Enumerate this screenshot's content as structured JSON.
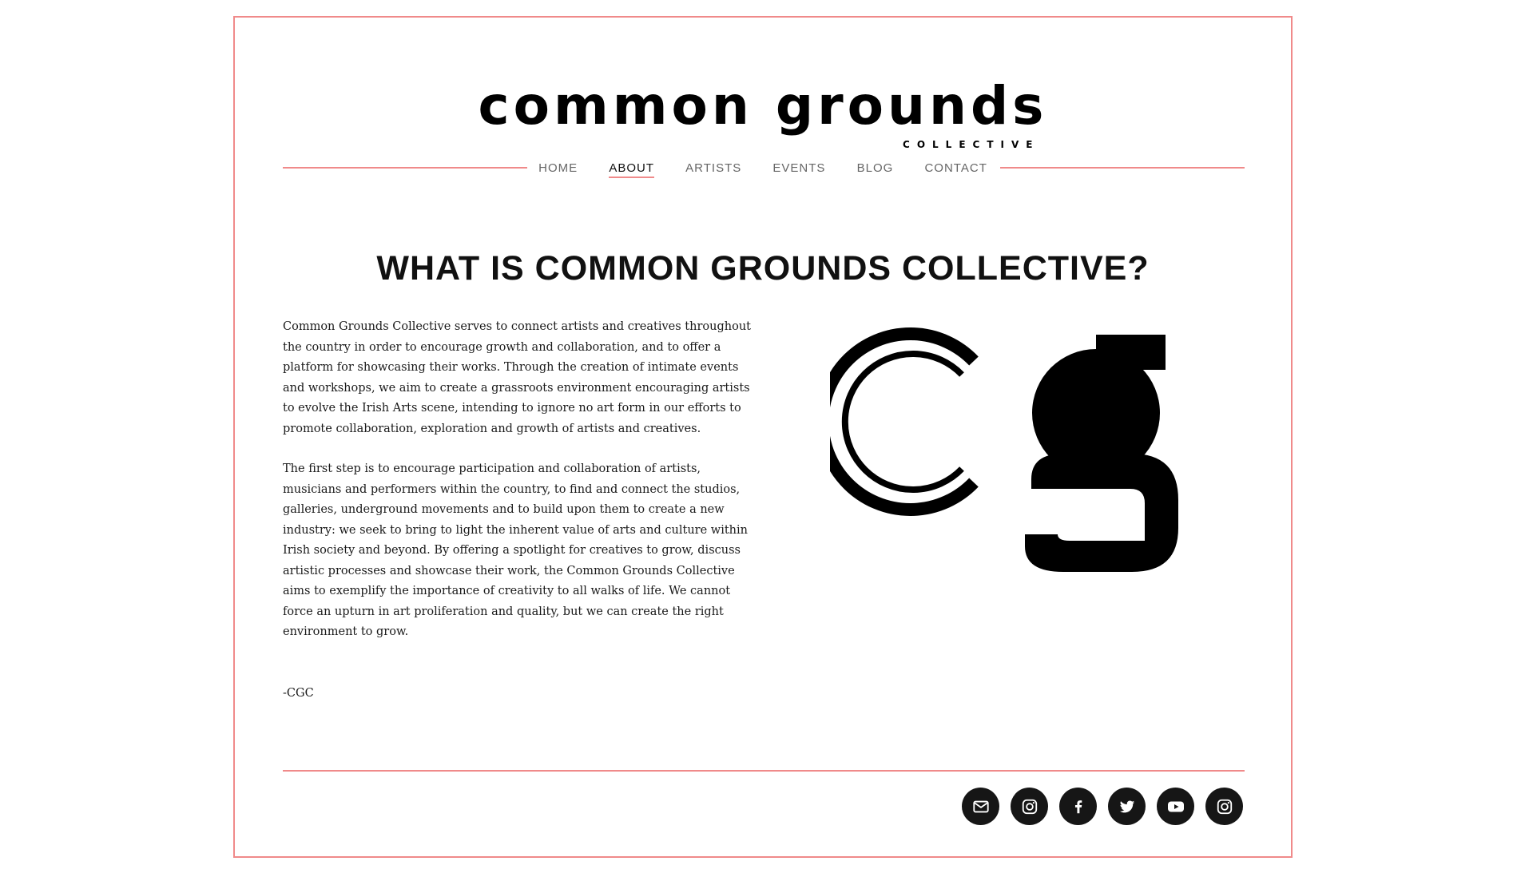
{
  "logo": {
    "main": "common grounds",
    "sub": "COLLECTIVE"
  },
  "nav": {
    "items": [
      {
        "label": "HOME"
      },
      {
        "label": "ABOUT"
      },
      {
        "label": "ARTISTS"
      },
      {
        "label": "EVENTS"
      },
      {
        "label": "BLOG"
      },
      {
        "label": "CONTACT"
      }
    ],
    "active": "ABOUT"
  },
  "page": {
    "title": "WHAT IS COMMON GROUNDS COLLECTIVE?",
    "paragraphs": [
      "Common Grounds Collective serves to connect artists and creatives throughout the country in order to encourage growth and collaboration, and to offer a platform for showcasing their works. Through the creation of intimate events and workshops, we aim to create a grassroots environment encouraging artists to evolve the Irish Arts scene, intending to ignore no art form in our efforts to promote collaboration, exploration and growth of artists and creatives.",
      "The first step is to encourage participation and collaboration of artists, musicians and performers within the country, to find and connect the studios, galleries, underground movements and to build upon them to create a new industry: we seek to bring to light the inherent value of arts and culture within Irish society and beyond. By offering a spotlight for creatives to grow, discuss artistic processes and showcase their work, the Common Grounds Collective aims to exemplify the importance of creativity to all walks of life. We cannot force an upturn in art proliferation and quality, but we can create the right environment to grow."
    ],
    "signature": "-CGC"
  },
  "footer": {
    "social": [
      {
        "icon": "email-icon"
      },
      {
        "icon": "instagram-icon"
      },
      {
        "icon": "facebook-icon"
      },
      {
        "icon": "twitter-icon"
      },
      {
        "icon": "youtube-icon"
      },
      {
        "icon": "instagram-icon"
      }
    ]
  },
  "colors": {
    "accent": "#f08a8a",
    "text": "#1a1a1a",
    "icon_bg": "#161616"
  }
}
